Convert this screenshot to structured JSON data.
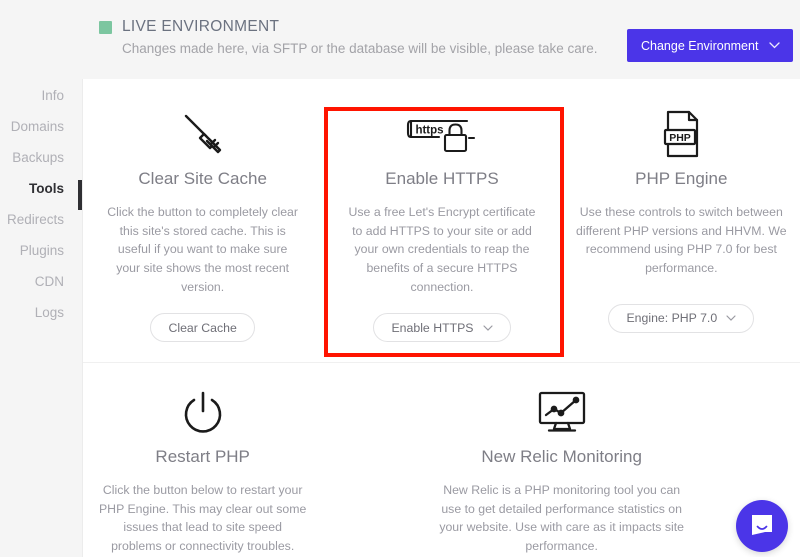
{
  "header": {
    "environment_label": "LIVE ENVIRONMENT",
    "environment_dot_color": "#7cc6a0",
    "subtitle": "Changes made here, via SFTP or the database will be visible, please take care.",
    "change_environment_button": "Change Environment",
    "change_environment_caret": "⌄",
    "accent_color": "#4b35e8"
  },
  "sidebar": {
    "items": [
      {
        "label": "Info",
        "active": false
      },
      {
        "label": "Domains",
        "active": false
      },
      {
        "label": "Backups",
        "active": false
      },
      {
        "label": "Tools",
        "active": true
      },
      {
        "label": "Redirects",
        "active": false
      },
      {
        "label": "Plugins",
        "active": false
      },
      {
        "label": "CDN",
        "active": false
      },
      {
        "label": "Logs",
        "active": false
      }
    ]
  },
  "cards": [
    {
      "icon": "broom-icon",
      "title": "Clear Site Cache",
      "description": "Click the button to completely clear this site's stored cache. This is useful if you want to make sure your site shows the most recent version.",
      "button": "Clear Cache",
      "has_caret": false
    },
    {
      "icon": "https-padlock-icon",
      "title": "Enable HTTPS",
      "description": "Use a free Let's Encrypt certificate to add HTTPS to your site or add your own credentials to reap the benefits of a secure HTTPS connection.",
      "button": "Enable HTTPS",
      "has_caret": true,
      "highlighted": true
    },
    {
      "icon": "php-file-icon",
      "title": "PHP Engine",
      "description": "Use these controls to switch between different PHP versions and HHVM. We recommend using PHP 7.0 for best performance.",
      "button": "Engine: PHP 7.0",
      "has_caret": true
    },
    {
      "icon": "power-icon",
      "title": "Restart PHP",
      "description": "Click the button below to restart your PHP Engine. This may clear out some issues that lead to site speed problems or connectivity troubles.",
      "button": null,
      "has_caret": false
    },
    {
      "icon": "monitor-chart-icon",
      "title": "New Relic Monitoring",
      "description": "New Relic is a PHP monitoring tool you can use to get detailed performance statistics on your website. Use with care as it impacts site performance.",
      "button": null,
      "has_caret": false
    }
  ],
  "annotations": {
    "highlight_color": "#ff1400",
    "highlight_target": "Enable HTTPS"
  },
  "chat": {
    "icon": "chat-bubble-icon",
    "color": "#4b35e8"
  }
}
